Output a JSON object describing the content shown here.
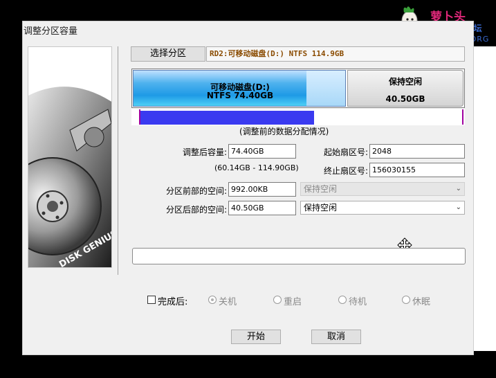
{
  "watermark": {
    "logo_text": "萝卜头",
    "sub_text": "IT论坛",
    "url": "BBS.LUOBOTOU.ORG"
  },
  "dialog": {
    "title": "调整分区容量",
    "select_partition_label": "选择分区",
    "disk_info": "RD2:可移动磁盘(D:) NTFS 114.9GB"
  },
  "partition_bar": {
    "used_name": "可移动磁盘(D:)",
    "used_detail": "NTFS 74.40GB",
    "free_name": "保持空闲",
    "free_size": "40.50GB",
    "caption": "(调整前的数据分配情况)",
    "used_fraction": 0.647
  },
  "form": {
    "new_size_label": "调整后容量:",
    "new_size_value": "74.40GB",
    "size_range": "(60.14GB - 114.90GB)",
    "start_sector_label": "起始扇区号:",
    "start_sector_value": "2048",
    "end_sector_label": "终止扇区号:",
    "end_sector_value": "156030155",
    "before_space_label": "分区前部的空间:",
    "before_space_value": "992.00KB",
    "before_space_action": "保持空闲",
    "after_space_label": "分区后部的空间:",
    "after_space_value": "40.50GB",
    "after_space_action": "保持空闲"
  },
  "completion": {
    "checkbox_label": "完成后:",
    "options": [
      "关机",
      "重启",
      "待机",
      "休眠"
    ],
    "selected": "关机"
  },
  "buttons": {
    "start": "开始",
    "cancel": "取消"
  },
  "colors": {
    "partition_blue": "#1e9ae6",
    "strip_blue": "#3a3af0",
    "disk_info_text": "#8a4b00",
    "watermark_pink": "#e0287a",
    "watermark_blue": "#3a6ad0"
  },
  "icons": {
    "watermark": "radish-mascot-icon",
    "cursor": "move-cursor-icon",
    "combo_arrow": "chevron-down-icon"
  }
}
